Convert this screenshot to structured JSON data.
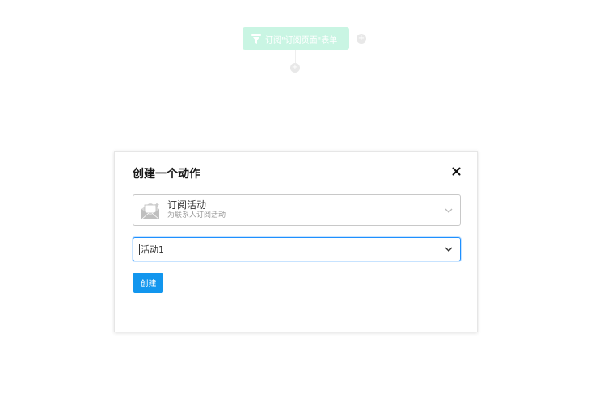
{
  "workflow": {
    "trigger_node_label": "订阅\"订阅页面\"表单",
    "add_icon": "+"
  },
  "modal": {
    "title": "创建一个动作",
    "close_icon": "close-icon",
    "action_select": {
      "icon": "mail-open-icon",
      "name": "订阅活动",
      "description": "为联系人订阅活动"
    },
    "campaign_select": {
      "value": "活动1"
    },
    "create_button_label": "创建"
  },
  "colors": {
    "primary": "#1296ee",
    "focus_border": "#1e90ff",
    "trigger_node_bg": "#c9f5e3"
  }
}
